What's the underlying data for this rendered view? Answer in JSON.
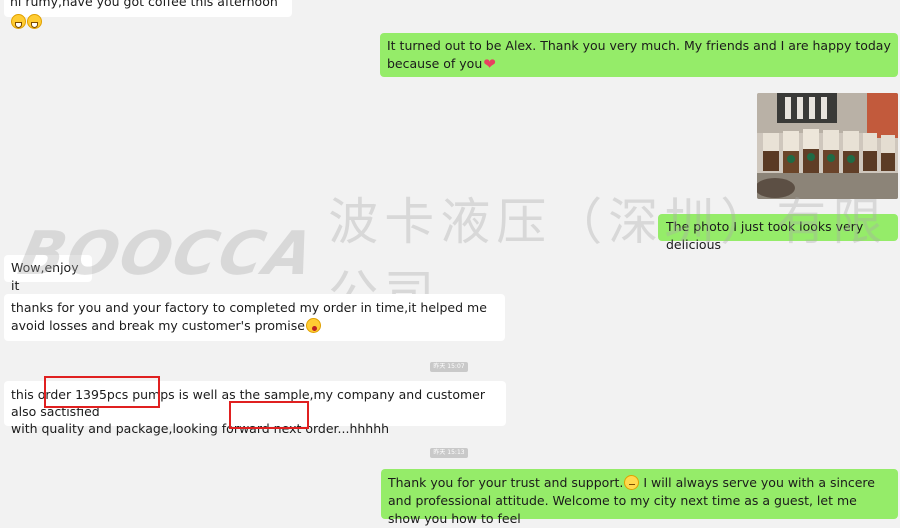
{
  "messages": {
    "m1": {
      "text": "hi rumy,have you got coffee this afternoon"
    },
    "m2": {
      "text": "It turned out to be Alex. Thank you very much. My friends and I are happy today because of you"
    },
    "m3": {
      "text": "The photo I just took looks very delicious"
    },
    "m4": {
      "text": "Wow,enjoy it"
    },
    "m5": {
      "text": "thanks for you and your factory to completed my order in time,it helped me avoid losses and break my customer's promise"
    },
    "m6": {
      "line1_pre": "this or",
      "line1_hl": "der 1395pcs pumps",
      "line1_post": " is well as the sample,my company and customer also sactisfied",
      "line2_pre": "with quality and package,looking forwa",
      "line2_hl": "rd next order",
      "line2_post": "...hhhhh"
    },
    "m7": {
      "text": "Thank you for your trust and support.",
      "text2": " I will always serve you with a sincere and professional attitude. Welcome to my city next time as a guest, let me show you how to feel"
    }
  },
  "timestamps": {
    "t1": "昨天 15:07",
    "t2": "昨天 15:13"
  },
  "watermark": {
    "logo": "BOOCCA",
    "company": "波卡液压（深圳）有限公司"
  },
  "colors": {
    "background": "#f2f2f2",
    "incoming": "#ffffff",
    "outgoing": "#95ec69",
    "highlight_box": "#e02020"
  },
  "icons": [
    "grin-emoji",
    "heart-emoji",
    "shocked-emoji",
    "nervous-smile-emoji"
  ]
}
